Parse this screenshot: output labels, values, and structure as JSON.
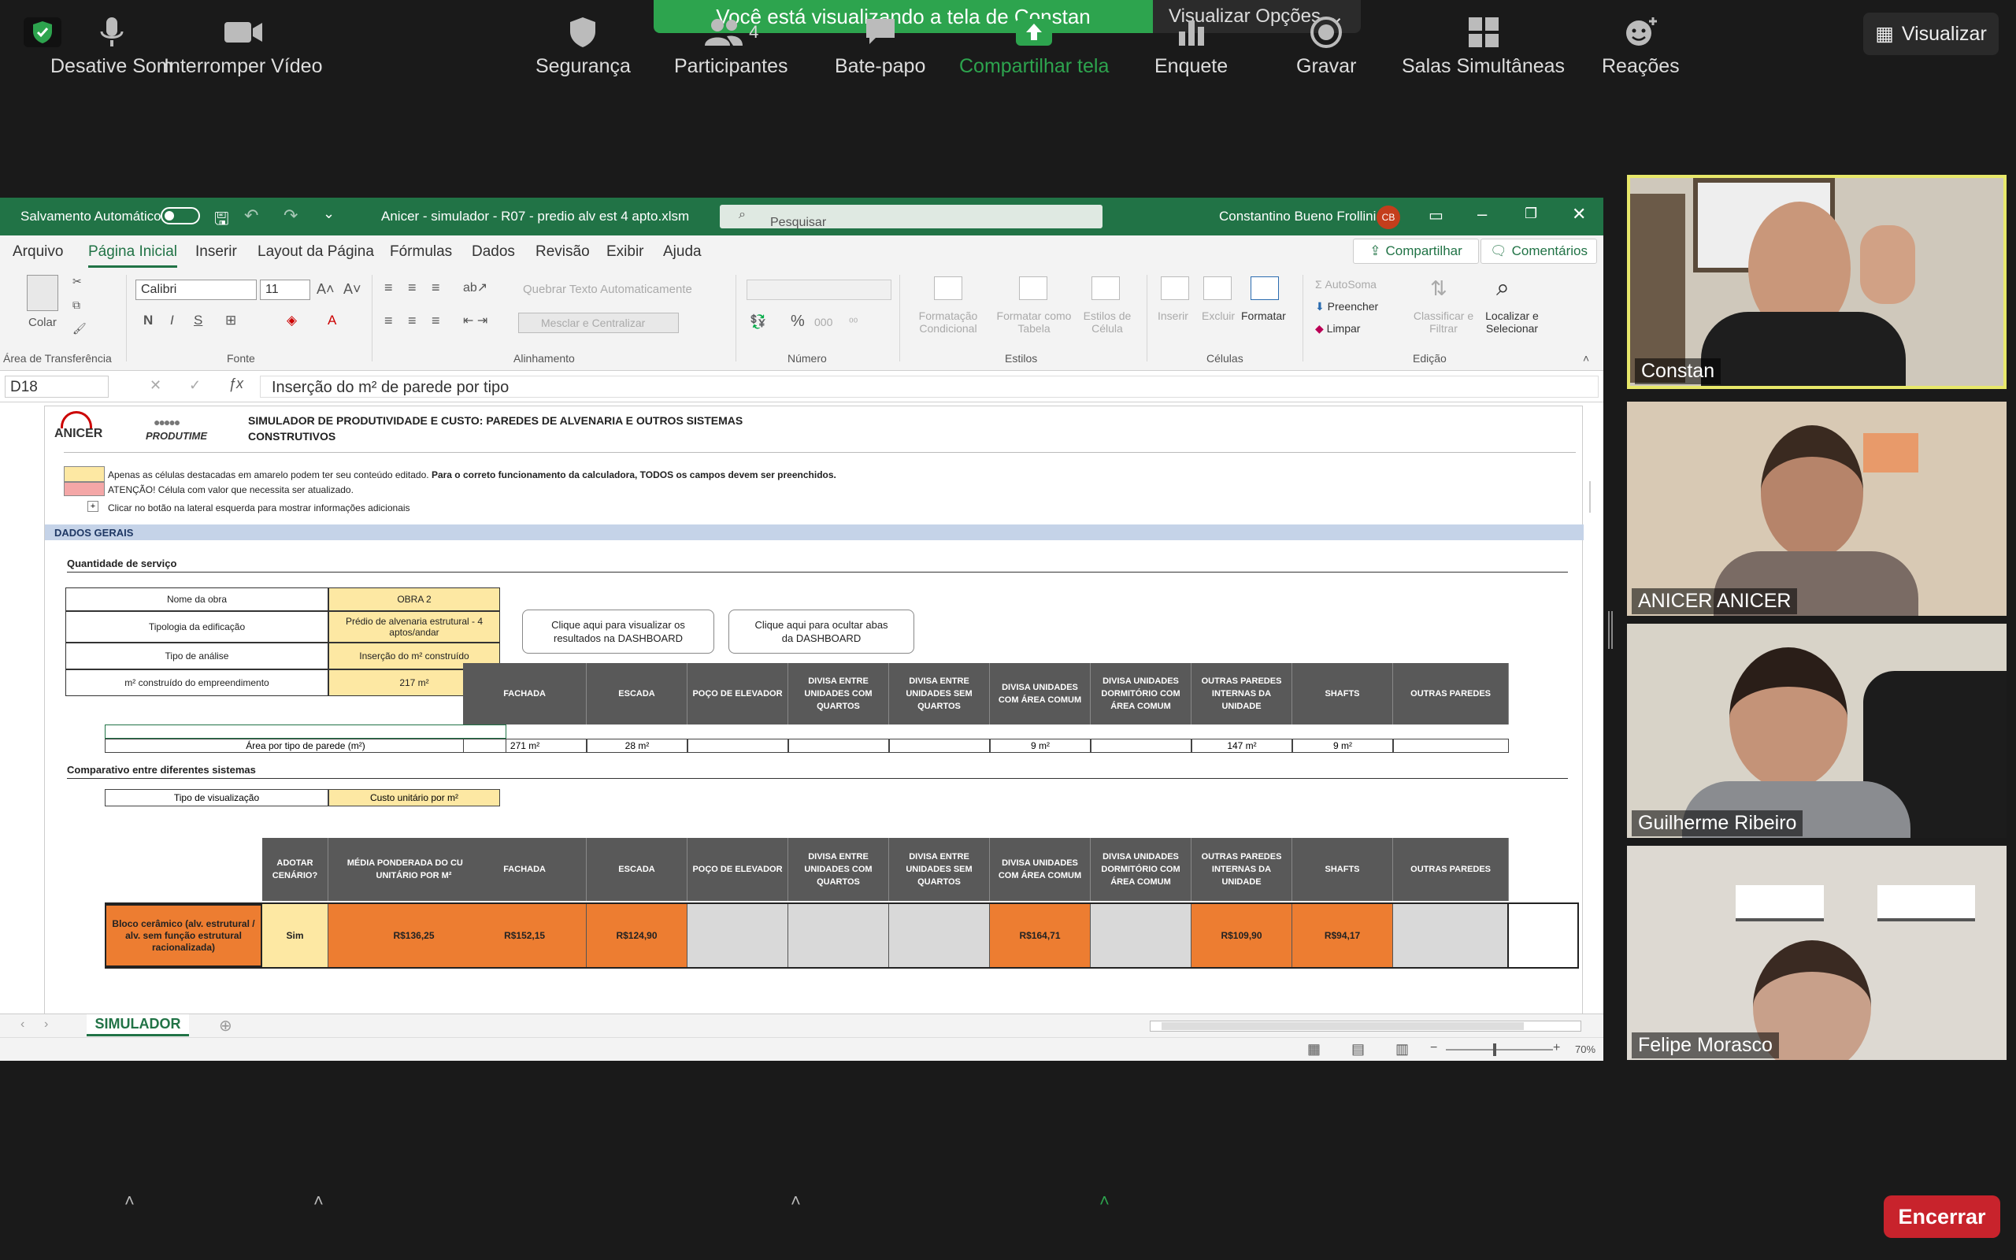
{
  "zoom": {
    "share_message": "Você está visualizando a tela de Constan",
    "view_options": "Visualizar Opções",
    "view_button": "Visualizar",
    "colors": {
      "share_green": "#2da44e",
      "end_red": "#c8232c"
    },
    "toolbar": {
      "mute": "Desative Som",
      "video": "Interromper Vídeo",
      "security": "Segurança",
      "participants": "Participantes",
      "participants_count": "4",
      "chat": "Bate-papo",
      "share": "Compartilhar tela",
      "poll": "Enquete",
      "record": "Gravar",
      "breakout": "Salas Simultâneas",
      "reactions": "Reações",
      "end": "Encerrar"
    },
    "participants": [
      {
        "name": "Constan"
      },
      {
        "name": "ANICER ANICER"
      },
      {
        "name": "Guilherme Ribeiro"
      },
      {
        "name": "Felipe Morasco"
      }
    ]
  },
  "excel": {
    "autosave": "Salvamento Automático",
    "filename": "Anicer - simulador - R07 - predio alv est 4 apto.xlsm",
    "search": "Pesquisar",
    "user": "Constantino Bueno Frollini",
    "user_initials": "CB",
    "menu": [
      "Arquivo",
      "Página Inicial",
      "Inserir",
      "Layout da Página",
      "Fórmulas",
      "Dados",
      "Revisão",
      "Exibir",
      "Ajuda"
    ],
    "share": "Compartilhar",
    "comments": "Comentários",
    "ribbon": {
      "paste": "Colar",
      "clipboard": "Área de Transferência",
      "font_name": "Calibri",
      "font_size": "11",
      "font": "Fonte",
      "wrap": "Quebrar Texto Automaticamente",
      "merge": "Mesclar e Centralizar",
      "alignment": "Alinhamento",
      "number": "Número",
      "cond_fmt": "Formatação Condicional",
      "fmt_table": "Formatar como Tabela",
      "cell_styles": "Estilos de Célula",
      "styles": "Estilos",
      "insert": "Inserir",
      "delete": "Excluir",
      "format": "Formatar",
      "cells": "Células",
      "autosum": "AutoSoma",
      "fill": "Preencher",
      "clear": "Limpar",
      "sort": "Classificar e Filtrar",
      "find": "Localizar e Selecionar",
      "editing": "Edição"
    },
    "namebox": "D18",
    "formula": "Inserção do m² de parede por tipo",
    "sheet_tab": "SIMULADOR",
    "zoom_level": "70%"
  },
  "sheet": {
    "logo1": "ANICER",
    "logo2": "PRODUTIME",
    "title1": "SIMULADOR DE PRODUTIVIDADE E CUSTO: PAREDES DE ALVENARIA E OUTROS SISTEMAS",
    "title2": "CONSTRUTIVOS",
    "note1": "Apenas as células destacadas em amarelo podem ter seu conteúdo editado.",
    "note1b": "Para o correto funcionamento da calculadora, TODOS os campos devem ser preenchidos.",
    "note2": "ATENÇÃO! Célula com valor que necessita ser atualizado.",
    "note3": "Clicar no botão na lateral esquerda para mostrar informações adicionais",
    "section1": "DADOS GERAIS",
    "sub1": "Quantidade de serviço",
    "fields": [
      {
        "label": "Nome da obra",
        "value": "OBRA 2"
      },
      {
        "label": "Tipologia da edificação",
        "value": "Prédio de alvenaria estrutural - 4 aptos/andar"
      },
      {
        "label": "Tipo de análise",
        "value": "Inserção do m² construído"
      },
      {
        "label": "m² construído do empreendimento",
        "value": "217 m²"
      }
    ],
    "btn_show": "Clique aqui para visualizar os resultados na DASHBOARD",
    "btn_hide": "Clique aqui para ocultar abas da DASHBOARD",
    "wall_headers": [
      "FACHADA",
      "ESCADA",
      "POÇO DE ELEVADOR",
      "DIVISA ENTRE UNIDADES COM QUARTOS",
      "DIVISA ENTRE UNIDADES SEM QUARTOS",
      "DIVISA UNIDADES COM ÁREA COMUM",
      "DIVISA UNIDADES DORMITÓRIO COM ÁREA COMUM",
      "OUTRAS PAREDES INTERNAS DA UNIDADE",
      "SHAFTS",
      "OUTRAS PAREDES"
    ],
    "area_label": "Área por tipo de parede (m²)",
    "area_values": [
      "271 m²",
      "28 m²",
      "",
      "",
      "",
      "9 m²",
      "",
      "147 m²",
      "9 m²",
      ""
    ],
    "sub2": "Comparativo entre diferentes sistemas",
    "view_type_label": "Tipo de visualização",
    "view_type_value": "Custo unitário por m²",
    "adopt_header": "ADOTAR CENÁRIO?",
    "avg_header": "MÉDIA PONDERADA DO CUSTO UNITÁRIO POR M²",
    "system_name": "Bloco cerâmico (alv. estrutural / alv. sem função estrutural racionalizada)",
    "system_adopt": "Sim",
    "system_avg": "R$136,25",
    "system_values": [
      "R$152,15",
      "R$124,90",
      "",
      "",
      "",
      "R$164,71",
      "",
      "R$109,90",
      "R$94,17",
      ""
    ]
  }
}
